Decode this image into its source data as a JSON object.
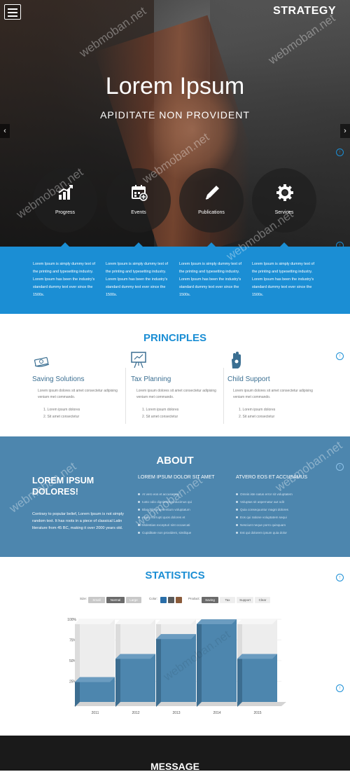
{
  "header": {
    "brand": "STRATEGY",
    "menu_icon": "hamburger-icon"
  },
  "hero": {
    "title": "Lorem Ipsum",
    "subtitle": "APIDITATE NON PROVIDENT",
    "prev_arrow": "‹",
    "next_arrow": "›"
  },
  "features": [
    {
      "label": "Progress",
      "icon": "chart-growth-icon"
    },
    {
      "label": "Events",
      "icon": "calendar-icon"
    },
    {
      "label": "Publications",
      "icon": "pen-icon"
    },
    {
      "label": "Services",
      "icon": "gear-icon"
    }
  ],
  "band": {
    "texts": [
      "Lorem Ipsum is simply dummy text of the printing and typesetting industry. Lorem Ipsum has been the industry's standard dummy text ever since the 1500s.",
      "Lorem Ipsum is simply dummy text of the printing and typesetting industry. Lorem Ipsum has been the industry's standard dummy text ever since the 1500s.",
      "Lorem Ipsum is simply dummy text of the printing and typesetting industry. Lorem Ipsum has been the industry's standard dummy text ever since the 1500s.",
      "Lorem Ipsum is simply dummy text of the printing and typesetting industry. Lorem Ipsum has been the industry's standard dummy text ever since the 1500s."
    ]
  },
  "principles": {
    "title": "PRINCIPLES",
    "items": [
      {
        "title": "Saving Solutions",
        "icon": "money-icon",
        "desc": "Lorem ipsum dolores sit amet consectetur adipising veniam met commando.",
        "list": [
          "1. Lorem ipsum dolores",
          "2. Sit amet consectetur"
        ]
      },
      {
        "title": "Tax Planning",
        "icon": "presentation-board-icon",
        "desc": "Lorem ipsum dolores sit amet consectetur adipising veniam met commando.",
        "list": [
          "1. Lorem ipsum dolores",
          "2. Sit amet consectetur"
        ]
      },
      {
        "title": "Child Support",
        "icon": "hand-icon",
        "desc": "Lorem ipsum dolores sit amet consectetur adipising veniam met commando.",
        "list": [
          "1. Lorem ipsum dolores",
          "2. Sit amet consectetur"
        ]
      }
    ]
  },
  "about": {
    "title": "ABOUT",
    "big": "LOREM IPSUM DOLORES!",
    "body": "Contrary to popular belief, Lorem Ipsum is not simply random text. It has roots in a piece of classical Latin literature from 45 BC, making it over 2000 years old.",
    "col1": {
      "heading": "LOREM IPSUM DOLOR SIT AMET",
      "items": [
        "At vero eos et accusamus",
        "Iusto odio dignissimos ducimus qui",
        "Blanditiis praesentium voluptatum",
        "Atque corrupti quos dolores et",
        "Molestias excepturi sint occaecati",
        "Cupiditate non provident, similique"
      ]
    },
    "col2": {
      "heading": "ATVERO EOS ET ACCUSAMUS",
      "items": [
        "Omnis iste natus error sit voluptatem",
        "Voluptas sit aspernatur aut odit",
        "Quia consequuntur magni dolores",
        "Eos qui ratione voluptatem sequi",
        "Nesciunt neque porro quisquam",
        "Est qui dolorem ipsum quia dolor"
      ]
    }
  },
  "statistics": {
    "title": "STATISTICS",
    "controls": {
      "size_label": "Size:",
      "size_options": [
        "Small",
        "Normal",
        "Large"
      ],
      "size_selected": "Normal",
      "color_label": "Color:",
      "color_swatches": [
        "#2a6ea8",
        "#5b5b5b",
        "#8a5b3a"
      ],
      "product_label": "Product:",
      "product_options": [
        "Saving",
        "Tax",
        "Support",
        "Clear"
      ],
      "product_selected": "Saving"
    }
  },
  "chart_data": {
    "type": "bar",
    "categories": [
      "2011",
      "2012",
      "2013",
      "2014",
      "2015"
    ],
    "values": [
      30,
      58,
      82,
      100,
      58
    ],
    "ytick_labels": [
      "100%",
      "75%",
      "50%",
      "25%"
    ],
    "ylim": [
      0,
      100
    ],
    "bar_color": "#4d86ae"
  },
  "message": {
    "title": "MESSAGE"
  },
  "watermark": "webmoban.net",
  "colors": {
    "accent": "#1b8ed4",
    "about_bg": "#4d86ae"
  }
}
